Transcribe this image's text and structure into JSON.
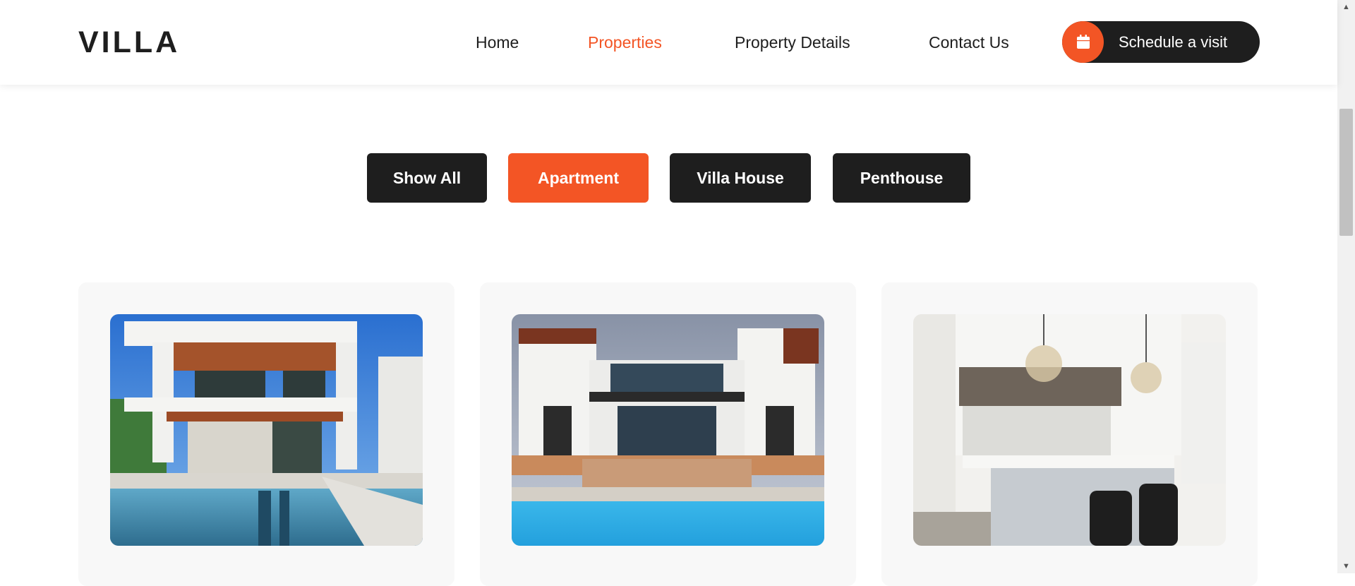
{
  "header": {
    "logo": "VILLA",
    "nav": [
      {
        "label": "Home",
        "active": false
      },
      {
        "label": "Properties",
        "active": true
      },
      {
        "label": "Property Details",
        "active": false
      },
      {
        "label": "Contact Us",
        "active": false
      }
    ],
    "cta": {
      "label": "Schedule a visit",
      "icon": "calendar-icon"
    }
  },
  "filters": [
    {
      "label": "Show All",
      "active": false
    },
    {
      "label": "Apartment",
      "active": true
    },
    {
      "label": "Villa House",
      "active": false
    },
    {
      "label": "Penthouse",
      "active": false
    }
  ],
  "properties": [
    {
      "image": "modern-villa-with-pool"
    },
    {
      "image": "white-house-with-blue-pool"
    },
    {
      "image": "white-kitchen-interior"
    }
  ],
  "colors": {
    "accent": "#f35525",
    "dark": "#1e1e1e",
    "card_bg": "#f8f8f8"
  }
}
